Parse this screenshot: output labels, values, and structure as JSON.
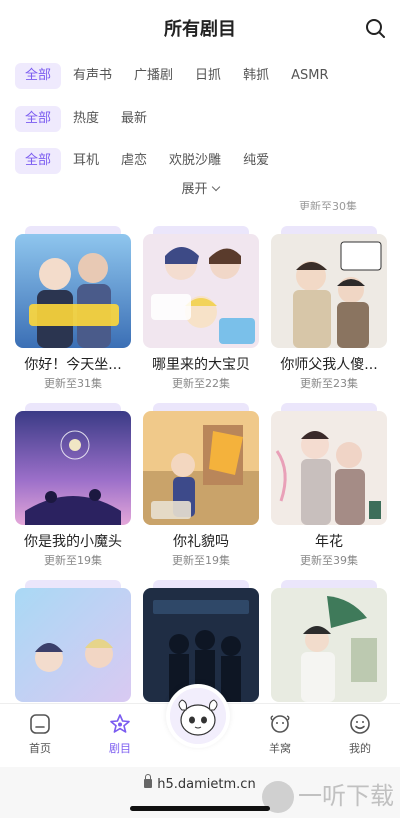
{
  "header": {
    "title": "所有剧目",
    "icon": "search-icon"
  },
  "filters": {
    "row1": [
      "全部",
      "有声书",
      "广播剧",
      "日抓",
      "韩抓",
      "ASMR"
    ],
    "row2": [
      "全部",
      "热度",
      "最新"
    ],
    "row3": [
      "全部",
      "耳机",
      "虐恋",
      "欢脱沙雕",
      "纯爱"
    ],
    "expand_label": "展开"
  },
  "peek_text": [
    "",
    "",
    "更新至30集"
  ],
  "cards": [
    {
      "name": "你好！今天坐...",
      "sub": "更新至31集"
    },
    {
      "name": "哪里来的大宝贝",
      "sub": "更新至22集"
    },
    {
      "name": "你师父我人傻...",
      "sub": "更新至23集"
    },
    {
      "name": "你是我的小魔头",
      "sub": "更新至19集"
    },
    {
      "name": "你礼貌吗",
      "sub": "更新至19集"
    },
    {
      "name": "年花",
      "sub": "更新至39集"
    },
    {
      "name": "",
      "sub": ""
    },
    {
      "name": "",
      "sub": ""
    },
    {
      "name": "",
      "sub": ""
    }
  ],
  "tabbar": {
    "items": [
      {
        "label": "首页",
        "icon": "home-icon"
      },
      {
        "label": "剧目",
        "icon": "star-icon"
      },
      {
        "label": "羊窝",
        "icon": "sheep-icon"
      },
      {
        "label": "我的",
        "icon": "smile-icon"
      }
    ],
    "center_icon": "mascot-avatar"
  },
  "browser": {
    "url": "h5.damietm.cn"
  },
  "watermark": {
    "text": "一听下载"
  },
  "colors": {
    "accent": "#7b5cf0",
    "chip_bg": "#efeafd"
  }
}
